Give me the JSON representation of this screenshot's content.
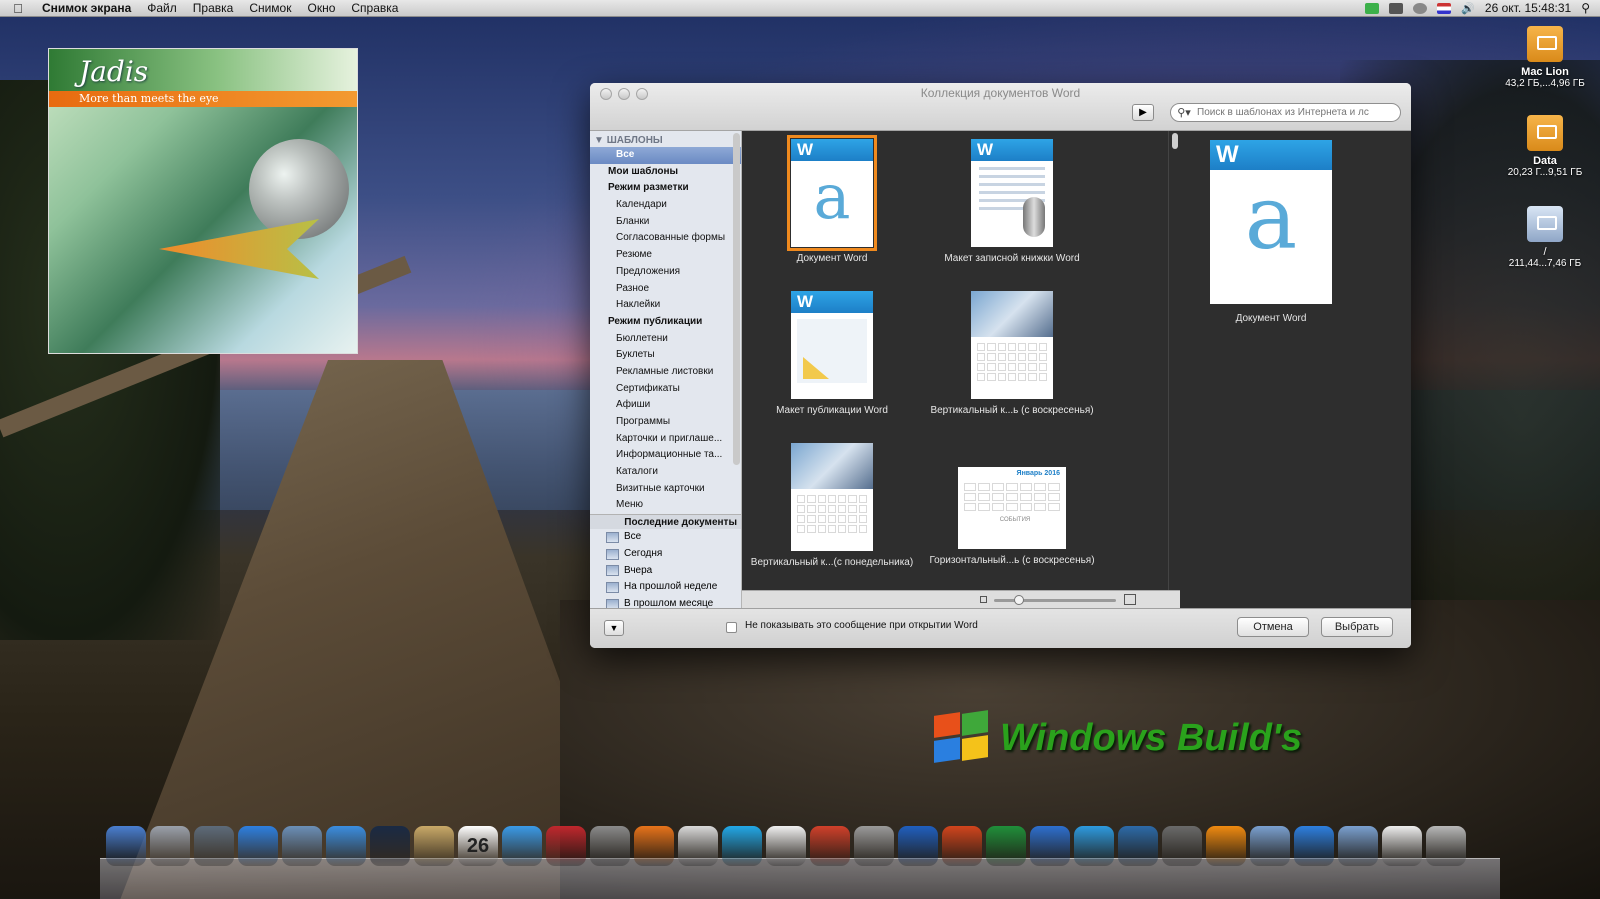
{
  "menubar": {
    "app_name": "Снимок экрана",
    "menus": [
      "Файл",
      "Правка",
      "Снимок",
      "Окно",
      "Справка"
    ],
    "clock": "26 окт. 15:48:31"
  },
  "album": {
    "title": "Jadis",
    "tagline": "More than meets the eye"
  },
  "desktop_icons": [
    {
      "name": "Mac Lion",
      "size": "43,2 ГБ,...4,96 ГБ"
    },
    {
      "name": "Data",
      "size": "20,23 Г...9,51 ГБ"
    },
    {
      "name": "/",
      "size": "211,44...7,46 ГБ"
    }
  ],
  "window": {
    "title": "Коллекция документов Word",
    "search_placeholder": "Поиск в шаблонах из Интернета и лс",
    "sidebar": {
      "section_header": "ШАБЛОНЫ",
      "items": [
        {
          "label": "Все",
          "style": "sel"
        },
        {
          "label": "Мои шаблоны",
          "style": "bold"
        },
        {
          "label": "Режим разметки",
          "style": "bold"
        },
        {
          "label": "Календари",
          "style": "sub"
        },
        {
          "label": "Бланки",
          "style": "sub"
        },
        {
          "label": "Согласованные формы",
          "style": "sub"
        },
        {
          "label": "Резюме",
          "style": "sub"
        },
        {
          "label": "Предложения",
          "style": "sub"
        },
        {
          "label": "Разное",
          "style": "sub"
        },
        {
          "label": "Наклейки",
          "style": "sub"
        },
        {
          "label": "Режим публикации",
          "style": "bold"
        },
        {
          "label": "Бюллетени",
          "style": "sub"
        },
        {
          "label": "Буклеты",
          "style": "sub"
        },
        {
          "label": "Рекламные листовки",
          "style": "sub"
        },
        {
          "label": "Сертификаты",
          "style": "sub"
        },
        {
          "label": "Афиши",
          "style": "sub"
        },
        {
          "label": "Программы",
          "style": "sub"
        },
        {
          "label": "Карточки и приглаше...",
          "style": "sub"
        },
        {
          "label": "Информационные та...",
          "style": "sub"
        },
        {
          "label": "Каталоги",
          "style": "sub"
        },
        {
          "label": "Визитные карточки",
          "style": "sub"
        },
        {
          "label": "Меню",
          "style": "sub"
        }
      ],
      "recent_header": "Последние документы",
      "recent_items": [
        "Все",
        "Сегодня",
        "Вчера",
        "На прошлой неделе",
        "В прошлом месяце"
      ]
    },
    "templates": [
      {
        "caption": "Документ Word",
        "kind": "doc"
      },
      {
        "caption": "Макет записной книжки Word",
        "kind": "notebook"
      },
      {
        "caption": "Макет публикации Word",
        "kind": "pub"
      },
      {
        "caption": "Вертикальный к...ь (с воскресенья)",
        "kind": "cal"
      },
      {
        "caption": "Вертикальный к...(с понедельника)",
        "kind": "cal"
      },
      {
        "caption": "Горизонтальный...ь (с воскресенья)",
        "kind": "hcal"
      }
    ],
    "hcal_month": "Январь 2016",
    "hcal_events": "СОБЫТИЯ",
    "doc_badge": "W",
    "doc_letter": "a",
    "preview_caption": "Документ Word",
    "checkbox_label": "Не показывать это сообщение при открытии Word",
    "cancel_label": "Отмена",
    "choose_label": "Выбрать"
  },
  "watermark": "Windows Build's",
  "dock": {
    "calendar_day": "26",
    "icons": [
      "finder-icon",
      "launchpad-icon",
      "system-icon",
      "app-store-icon",
      "preview-icon",
      "safari-icon",
      "photo-booth-icon",
      "address-book-icon",
      "ical-icon",
      "itunes-icon",
      "books-icon",
      "system-preferences-icon",
      "firefox-icon",
      "scissors-icon",
      "skype-icon",
      "textedit-icon",
      "burn-icon",
      "downloads-icon",
      "word-icon",
      "powerpoint-icon",
      "excel-icon",
      "outlook-icon",
      "messenger-icon",
      "network-icon",
      "satellite-icon",
      "vlc-icon",
      "folder-icon",
      "app-store-folder-icon",
      "documents-icon",
      "txt-icon",
      "trash-icon"
    ],
    "colors": [
      "#4a7fd1",
      "#9aa0aa",
      "#5d6b7a",
      "#2d7fe0",
      "#6b8fb8",
      "#3a8de0",
      "#1a2a44",
      "#c9a968",
      "#ffffff",
      "#3a9ae8",
      "#c0272d",
      "#8a8a8a",
      "#e8731a",
      "#d9d9d9",
      "#22a8e8",
      "#f0f0f0",
      "#d0402a",
      "#9a9a9a",
      "#1f5fbf",
      "#d1441c",
      "#1f8f3a",
      "#2d6fcf",
      "#2d9ae0",
      "#2c6aa8",
      "#6a6a6a",
      "#f08a10",
      "#7aa0d0",
      "#2d7fe0",
      "#7aa0d0",
      "#eeeeee",
      "#b8b8b8"
    ]
  }
}
